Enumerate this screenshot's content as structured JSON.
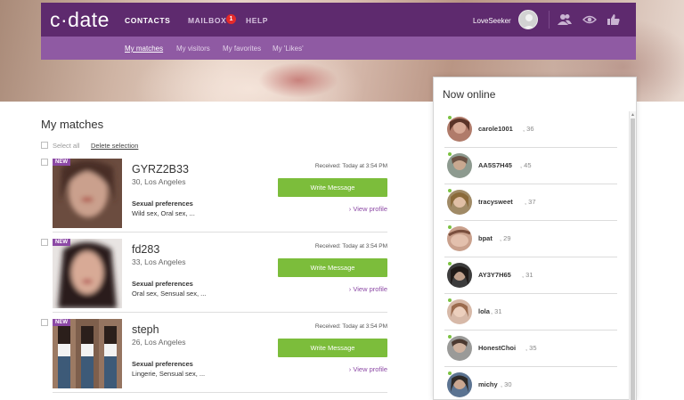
{
  "header": {
    "logo": "c·date",
    "nav": [
      {
        "label": "CONTACTS",
        "active": true
      },
      {
        "label": "MAILBOX",
        "active": false,
        "badge": "1"
      },
      {
        "label": "HELP",
        "active": false
      }
    ],
    "username": "LoveSeeker",
    "icons": [
      "contacts-icon",
      "eye-icon",
      "thumbs-up-icon"
    ],
    "colors": {
      "top": "#5e2a6e",
      "sub": "#8f5aa3",
      "accent": "#7cbd3b"
    }
  },
  "subnav": [
    {
      "label": "My matches",
      "active": true
    },
    {
      "label": "My visitors",
      "active": false
    },
    {
      "label": "My favorites",
      "active": false
    },
    {
      "label": "My 'Likes'",
      "active": false
    }
  ],
  "matches": {
    "title": "My matches",
    "select_all": "Select all",
    "delete_selection": "Delete selection",
    "items": [
      {
        "tag": "NEW",
        "name": "GYRZ2B33",
        "meta": "30, Los Angeles",
        "pref_heading": "Sexual preferences",
        "prefs": "Wild sex, Oral sex, ...",
        "received": "Received: Today at 3:54 PM",
        "write": "Write Message",
        "view": "View profile"
      },
      {
        "tag": "NEW",
        "name": "fd283",
        "meta": "33, Los Angeles",
        "pref_heading": "Sexual preferences",
        "prefs": "Oral sex, Sensual sex, ...",
        "received": "Received: Today at 3:54 PM",
        "write": "Write Message",
        "view": "View profile"
      },
      {
        "tag": "NEW",
        "name": "steph",
        "meta": "26, Los Angeles",
        "pref_heading": "Sexual preferences",
        "prefs": "Lingerie, Sensual sex, ...",
        "received": "Received: Today at 3:54 PM",
        "write": "Write Message",
        "view": "View profile"
      }
    ]
  },
  "online": {
    "title": "Now online",
    "users": [
      {
        "name": "carole1001",
        "age": "36"
      },
      {
        "name": "AA5S7H45",
        "age": "45"
      },
      {
        "name": "tracysweet",
        "age": "37"
      },
      {
        "name": "bpat",
        "age": "29"
      },
      {
        "name": "AY3Y7H65",
        "age": "31"
      },
      {
        "name": "lola",
        "age": "31"
      },
      {
        "name": "HonestChoi",
        "age": "35"
      },
      {
        "name": "michy",
        "age": "30"
      }
    ]
  }
}
